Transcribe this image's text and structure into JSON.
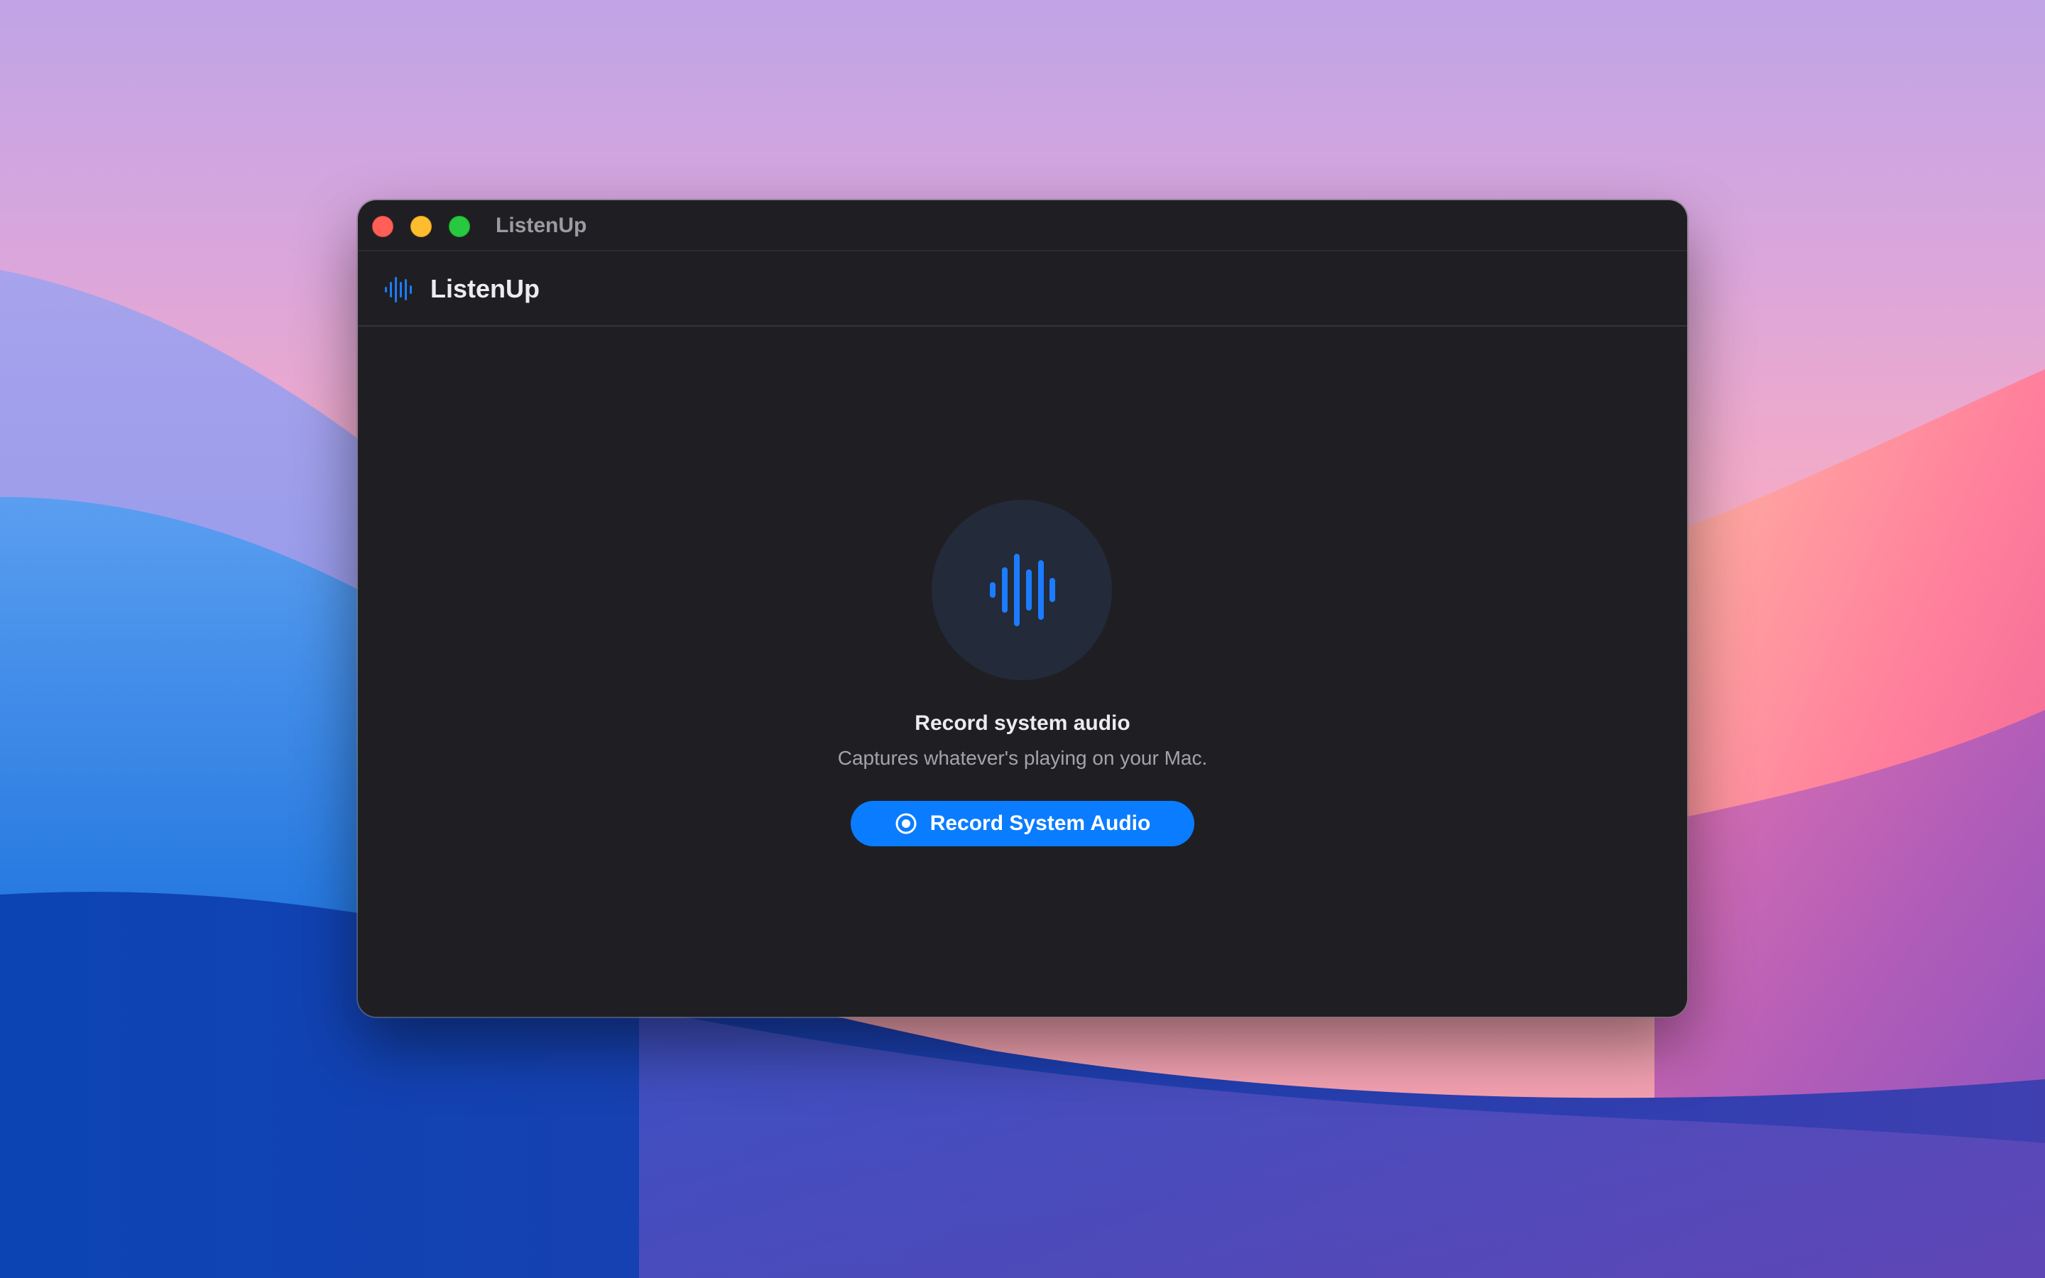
{
  "window": {
    "title": "ListenUp"
  },
  "header": {
    "logo_icon": "waveform-icon",
    "title": "ListenUp"
  },
  "empty_state": {
    "icon": "waveform-icon",
    "title": "Record system audio",
    "subtitle": "Captures whatever's playing on your Mac."
  },
  "record_button": {
    "icon": "record-circle-icon",
    "label": "Record System Audio"
  },
  "colors": {
    "accent": "#0a7cff",
    "window_background": "#1f1f23",
    "hero_circle": "#232a3a",
    "close": "#ff5f57",
    "minimize": "#febc2e",
    "zoom": "#28c840"
  }
}
